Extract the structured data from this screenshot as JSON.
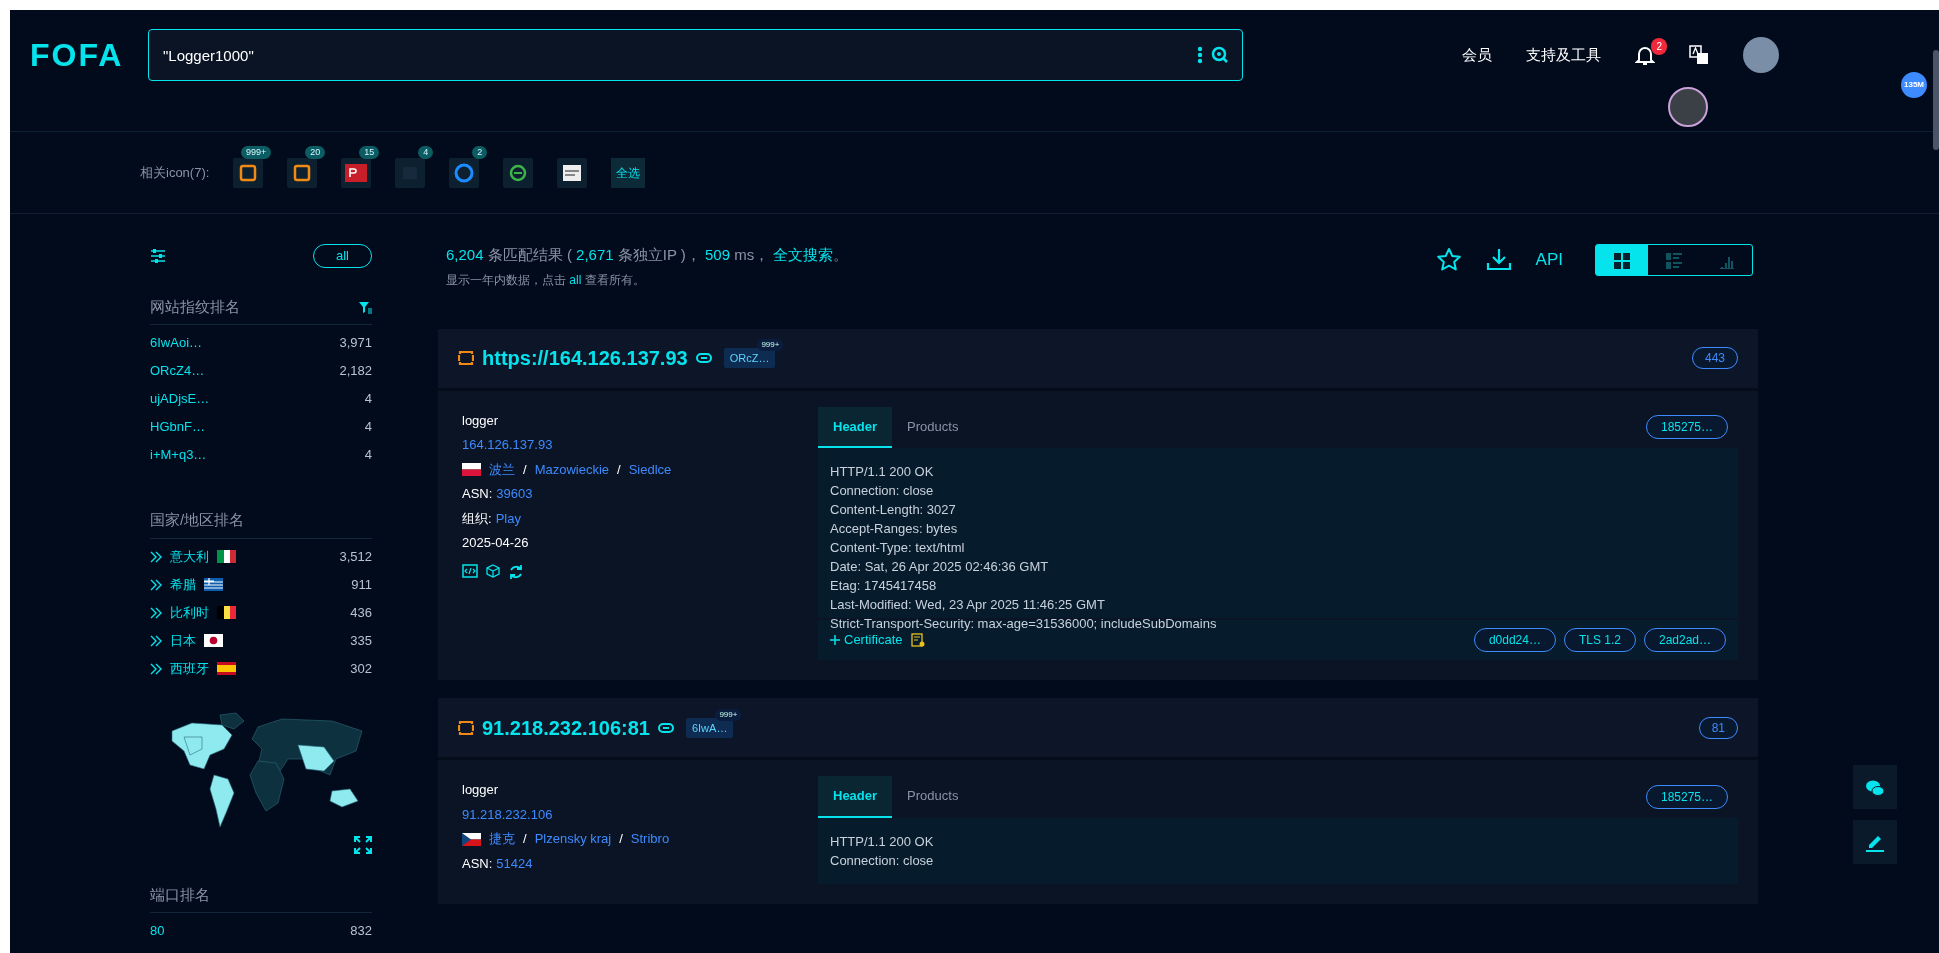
{
  "header": {
    "logo": "FOFA",
    "search": {
      "value": "\"Logger1000\""
    },
    "nav": [
      {
        "label": "会员"
      },
      {
        "label": "支持及工具"
      }
    ],
    "notifications": "2"
  },
  "floating_badge": "135M",
  "related_icons": {
    "label": "相关icon(7):",
    "items": [
      {
        "kind": "orange-frame",
        "count": "999+"
      },
      {
        "kind": "orange-frame",
        "count": "20"
      },
      {
        "kind": "red-logo",
        "count": "15"
      },
      {
        "kind": "dark",
        "count": "4"
      },
      {
        "kind": "blue-ring",
        "count": "2"
      },
      {
        "kind": "green-logo"
      },
      {
        "kind": "white-logo"
      }
    ],
    "select_all": "全选"
  },
  "sidebar": {
    "all_button": "all",
    "sections": [
      {
        "kind": "fingerprint",
        "title": "网站指纹排名",
        "items": [
          {
            "name": "6IwAoi…",
            "count": "3,971"
          },
          {
            "name": "ORcZ4…",
            "count": "2,182"
          },
          {
            "name": "ujADjsE…",
            "count": "4"
          },
          {
            "name": "HGbnF…",
            "count": "4"
          },
          {
            "name": "i+M+q3…",
            "count": "4"
          }
        ]
      },
      {
        "kind": "country",
        "title": "国家/地区排名",
        "items": [
          {
            "name": "意大利",
            "kind": "it",
            "count": "3,512"
          },
          {
            "name": "希腊",
            "kind": "gr",
            "count": "911"
          },
          {
            "name": "比利时",
            "kind": "be",
            "count": "436"
          },
          {
            "name": "日本",
            "kind": "jp",
            "count": "335"
          },
          {
            "name": "西班牙",
            "kind": "es",
            "count": "302"
          }
        ]
      },
      {
        "kind": "port",
        "title": "端口排名",
        "items": [
          {
            "name": "80",
            "count": "832"
          }
        ]
      }
    ]
  },
  "summary": {
    "total": "6,204",
    "total_text": "条匹配结果 (",
    "ips": "2,671",
    "ips_text": "条独立IP )，",
    "ms": "509",
    "ms_text": "ms，",
    "fulltext_link": "全文搜索",
    "tail": "。",
    "note_before": "显示一年内数据，点击",
    "note_link": "all",
    "note_after": "查看所有。"
  },
  "toolbar": {
    "api": "API",
    "views": [
      {
        "kind": "grid",
        "selected": true
      },
      {
        "kind": "list",
        "selected": false
      },
      {
        "kind": "chart",
        "selected": false
      }
    ]
  },
  "results": [
    {
      "url": "https://164.126.137.93",
      "tag": "ORcZ…",
      "tag_count": "999+",
      "port": "443",
      "title": "logger",
      "ip": "164.126.137.93",
      "location": {
        "kind": "pl",
        "parts": [
          "波兰",
          "Mazowieckie",
          "Siedlce"
        ],
        "separator": "/"
      },
      "asn_label": "ASN:",
      "asn": "39603",
      "org_label": "组织:",
      "org": "Play",
      "date": "2025-04-26",
      "tabs": [
        {
          "label": "Header",
          "selected": true
        },
        {
          "label": "Products",
          "selected": false
        }
      ],
      "hash": "185275…",
      "header_lines": [
        "HTTP/1.1 200 OK",
        "Connection: close",
        "Content-Length: 3027",
        "Accept-Ranges: bytes",
        "Content-Type: text/html",
        "Date: Sat, 26 Apr 2025 02:46:36 GMT",
        "Etag: 1745417458",
        "Last-Modified: Wed, 23 Apr 2025 11:46:25 GMT",
        "Strict-Transport-Security: max-age=31536000; includeSubDomains"
      ],
      "certificate": "Certificate",
      "cert_tags": [
        "d0dd24…",
        "TLS 1.2",
        "2ad2ad…"
      ]
    },
    {
      "url": "91.218.232.106:81",
      "tag": "6IwA…",
      "tag_count": "999+",
      "port": "81",
      "title": "logger",
      "ip": "91.218.232.106",
      "location": {
        "kind": "cz",
        "parts": [
          "捷克",
          "Plzensky kraj",
          "Stribro"
        ],
        "separator": "/"
      },
      "asn_label": "ASN:",
      "asn": "51424",
      "tabs": [
        {
          "label": "Header",
          "selected": true
        },
        {
          "label": "Products",
          "selected": false
        }
      ],
      "hash": "185275…",
      "header_lines": [
        "HTTP/1.1 200 OK",
        "Connection: close"
      ]
    }
  ]
}
